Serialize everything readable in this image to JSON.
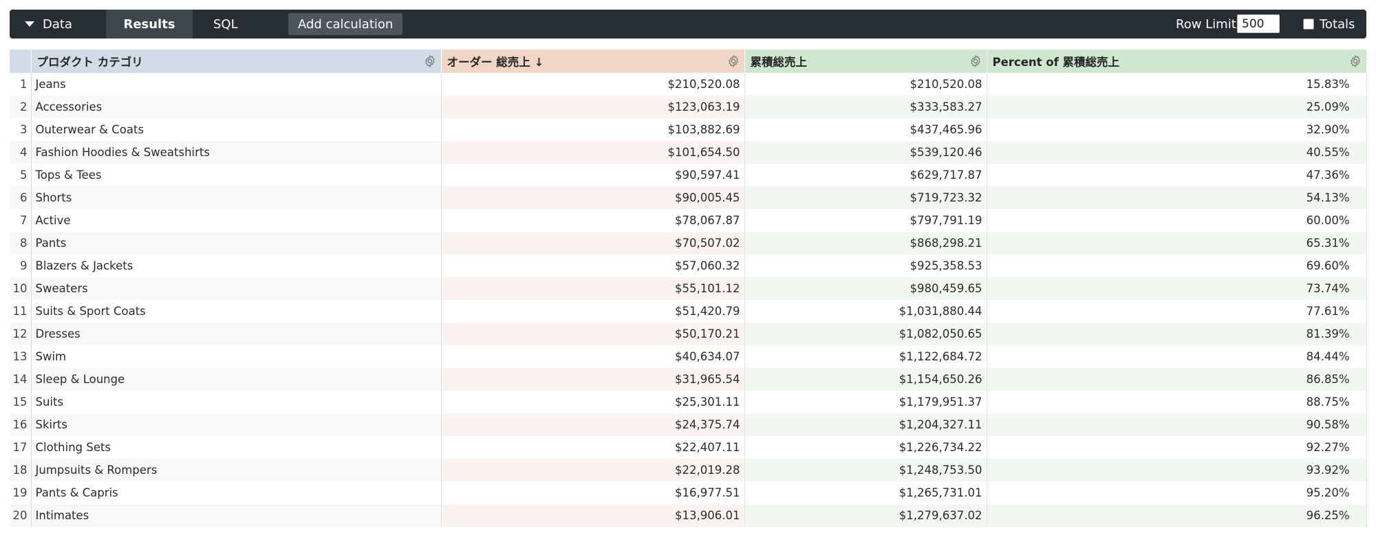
{
  "toolbar": {
    "data_label": "Data",
    "results_tab": "Results",
    "sql_tab": "SQL",
    "add_calculation": "Add calculation",
    "row_limit_label": "Row Limit",
    "row_limit_value": "500",
    "totals_label": "Totals"
  },
  "table": {
    "columns": {
      "category": "プロダクト カテゴリ",
      "sales": "オーダー 総売上 ↓",
      "cumulative": "累積総売上",
      "percent": "Percent of 累積総売上"
    },
    "header_colors": {
      "dimension": "#d2dce6",
      "measure": "#f0d6c4",
      "calculation": "#cfe6cf"
    },
    "rows": [
      {
        "n": "1",
        "category": "Jeans",
        "sales": "$210,520.08",
        "cumulative": "$210,520.08",
        "percent": "15.83%"
      },
      {
        "n": "2",
        "category": "Accessories",
        "sales": "$123,063.19",
        "cumulative": "$333,583.27",
        "percent": "25.09%"
      },
      {
        "n": "3",
        "category": "Outerwear & Coats",
        "sales": "$103,882.69",
        "cumulative": "$437,465.96",
        "percent": "32.90%"
      },
      {
        "n": "4",
        "category": "Fashion Hoodies & Sweatshirts",
        "sales": "$101,654.50",
        "cumulative": "$539,120.46",
        "percent": "40.55%"
      },
      {
        "n": "5",
        "category": "Tops & Tees",
        "sales": "$90,597.41",
        "cumulative": "$629,717.87",
        "percent": "47.36%"
      },
      {
        "n": "6",
        "category": "Shorts",
        "sales": "$90,005.45",
        "cumulative": "$719,723.32",
        "percent": "54.13%"
      },
      {
        "n": "7",
        "category": "Active",
        "sales": "$78,067.87",
        "cumulative": "$797,791.19",
        "percent": "60.00%"
      },
      {
        "n": "8",
        "category": "Pants",
        "sales": "$70,507.02",
        "cumulative": "$868,298.21",
        "percent": "65.31%"
      },
      {
        "n": "9",
        "category": "Blazers & Jackets",
        "sales": "$57,060.32",
        "cumulative": "$925,358.53",
        "percent": "69.60%"
      },
      {
        "n": "10",
        "category": "Sweaters",
        "sales": "$55,101.12",
        "cumulative": "$980,459.65",
        "percent": "73.74%"
      },
      {
        "n": "11",
        "category": "Suits & Sport Coats",
        "sales": "$51,420.79",
        "cumulative": "$1,031,880.44",
        "percent": "77.61%"
      },
      {
        "n": "12",
        "category": "Dresses",
        "sales": "$50,170.21",
        "cumulative": "$1,082,050.65",
        "percent": "81.39%"
      },
      {
        "n": "13",
        "category": "Swim",
        "sales": "$40,634.07",
        "cumulative": "$1,122,684.72",
        "percent": "84.44%"
      },
      {
        "n": "14",
        "category": "Sleep & Lounge",
        "sales": "$31,965.54",
        "cumulative": "$1,154,650.26",
        "percent": "86.85%"
      },
      {
        "n": "15",
        "category": "Suits",
        "sales": "$25,301.11",
        "cumulative": "$1,179,951.37",
        "percent": "88.75%"
      },
      {
        "n": "16",
        "category": "Skirts",
        "sales": "$24,375.74",
        "cumulative": "$1,204,327.11",
        "percent": "90.58%"
      },
      {
        "n": "17",
        "category": "Clothing Sets",
        "sales": "$22,407.11",
        "cumulative": "$1,226,734.22",
        "percent": "92.27%"
      },
      {
        "n": "18",
        "category": "Jumpsuits & Rompers",
        "sales": "$22,019.28",
        "cumulative": "$1,248,753.50",
        "percent": "93.92%"
      },
      {
        "n": "19",
        "category": "Pants & Capris",
        "sales": "$16,977.51",
        "cumulative": "$1,265,731.01",
        "percent": "95.20%"
      },
      {
        "n": "20",
        "category": "Intimates",
        "sales": "$13,906.01",
        "cumulative": "$1,279,637.02",
        "percent": "96.25%"
      }
    ]
  }
}
